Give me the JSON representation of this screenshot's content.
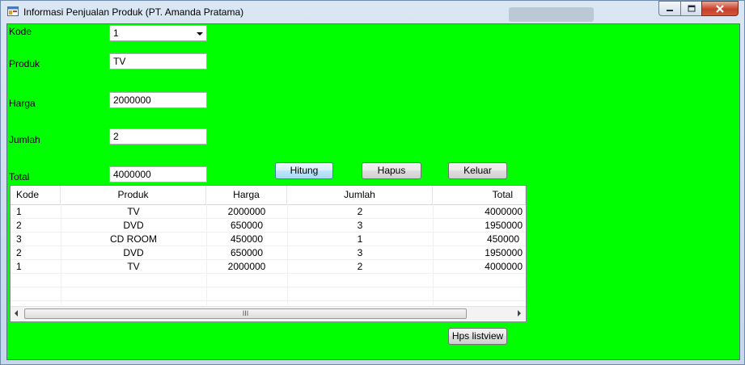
{
  "window": {
    "title": "Informasi Penjualan Produk (PT. Amanda Pratama)",
    "controls": {
      "minimize_icon": "minimize-icon",
      "maximize_icon": "maximize-icon",
      "close_icon": "close-icon"
    }
  },
  "colors": {
    "client_background": "#00ff00",
    "close_button": "#c7402a"
  },
  "form": {
    "kode": {
      "label": "Kode",
      "value": "1"
    },
    "produk": {
      "label": "Produk",
      "value": "TV"
    },
    "harga": {
      "label": "Harga",
      "value": "2000000"
    },
    "jumlah": {
      "label": "Jumlah",
      "value": "2"
    },
    "total": {
      "label": "Total",
      "value": "4000000"
    }
  },
  "buttons": {
    "hitung": "Hitung",
    "hapus": "Hapus",
    "keluar": "Keluar",
    "hps_listview": "Hps listview"
  },
  "listview": {
    "columns": [
      "Kode",
      "Produk",
      "Harga",
      "Jumlah",
      "Total"
    ],
    "rows": [
      [
        "1",
        "TV",
        "2000000",
        "2",
        "4000000"
      ],
      [
        "2",
        "DVD",
        "650000",
        "3",
        "1950000"
      ],
      [
        "3",
        "CD ROOM",
        "450000",
        "1",
        "450000"
      ],
      [
        "2",
        "DVD",
        "650000",
        "3",
        "1950000"
      ],
      [
        "1",
        "TV",
        "2000000",
        "2",
        "4000000"
      ]
    ],
    "scrollbar_grip": "III"
  }
}
